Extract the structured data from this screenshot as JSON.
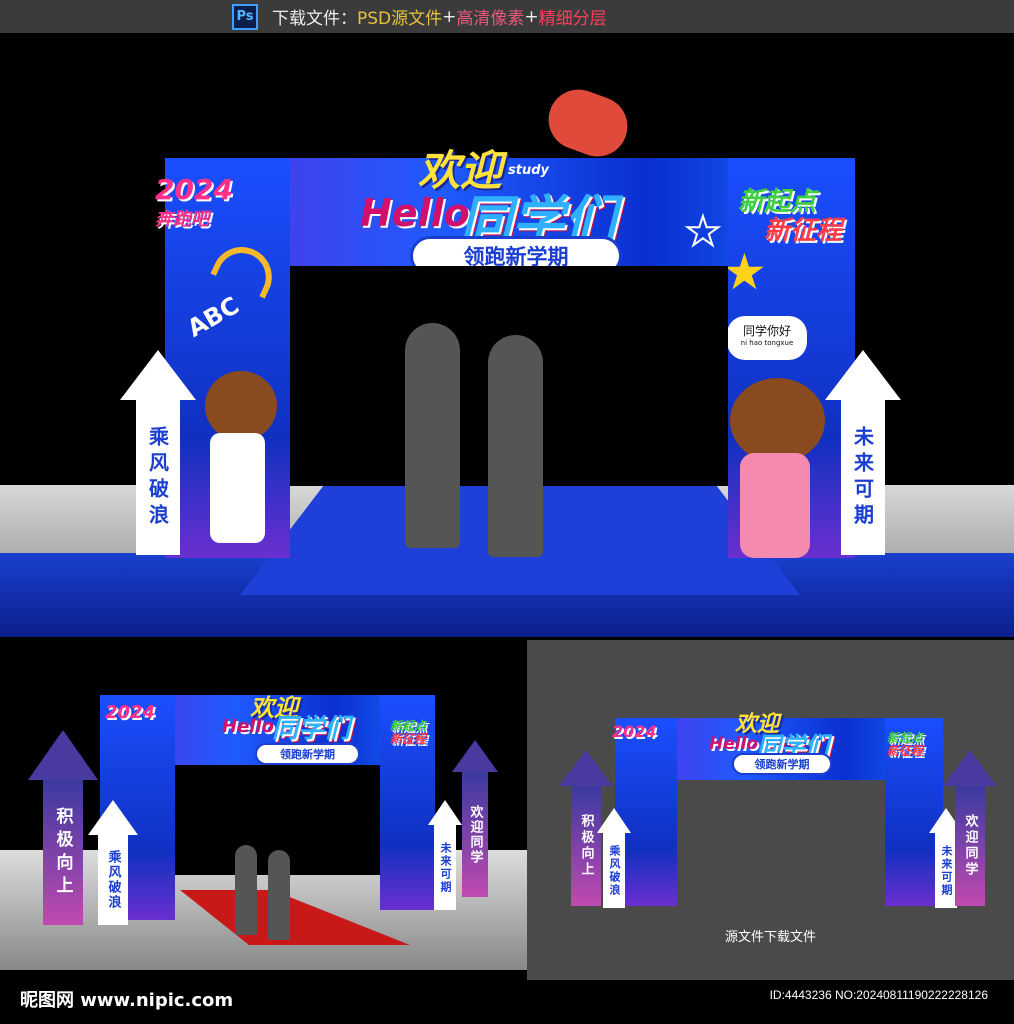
{
  "topbar": {
    "prefix": "下载文件：",
    "psd": "PSD源文件",
    "plus1": " + ",
    "hd": "高清像素",
    "plus2": "  + ",
    "layers": "精细分层",
    "ps_icon": "Ps"
  },
  "arch": {
    "welcome": "欢迎",
    "classmates": "同学们",
    "hello": "Hello",
    "study": "study",
    "subtitle": "领跑新学期",
    "year": "2024",
    "year_sub": "奔跑吧",
    "new_start_1": "新起点",
    "new_start_2": "新征程",
    "abc": "ABC",
    "greeting": "同学你好",
    "greeting_pinyin": "ni hao tongxue",
    "left_arrow": "乘风破浪",
    "right_arrow": "未来可期",
    "outer_left_arrow": "积极向上",
    "outer_right_arrow": "欢迎同学"
  },
  "panel_right": {
    "caption": "源文件下载文件"
  },
  "footer": {
    "logo": "昵图网 www.nipic.com",
    "id": "ID:4443236 NO:20240811190222228126"
  },
  "colors": {
    "arch_blue": "#1a4fff",
    "carpet_red": "#c81818",
    "accent_yellow": "#ffe33a"
  }
}
